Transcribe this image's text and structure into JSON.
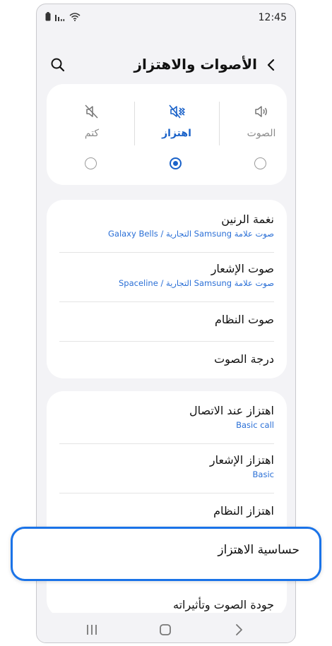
{
  "status_bar": {
    "time": "12:45",
    "icons": [
      "battery-icon",
      "signal-icon",
      "wifi-icon"
    ]
  },
  "header": {
    "title": "الأصوات والاهتزاز",
    "back_icon": "chevron-left-icon",
    "search_icon": "search-icon"
  },
  "sound_modes": {
    "items": [
      {
        "label": "الصوت",
        "icon": "volume-icon",
        "selected": false
      },
      {
        "label": "اهتزاز",
        "icon": "vibrate-icon",
        "selected": true
      },
      {
        "label": "كتم",
        "icon": "mute-icon",
        "selected": false
      }
    ]
  },
  "sound_settings": [
    {
      "title": "نغمة الرنين",
      "subtitle": "صوت علامة Samsung التجارية / Galaxy Bells"
    },
    {
      "title": "صوت الإشعار",
      "subtitle": "صوت علامة Samsung التجارية / Spaceline"
    },
    {
      "title": "صوت النظام"
    },
    {
      "title": "درجة الصوت"
    }
  ],
  "vibration_settings": [
    {
      "title": "اهتزاز عند الاتصال",
      "subtitle": "Basic call"
    },
    {
      "title": "اهتزاز الإشعار",
      "subtitle": "Basic"
    },
    {
      "title": "اهتزاز النظام"
    },
    {
      "title": "حساسية الاهتزاز",
      "highlighted": true
    },
    {
      "title": "جودة الصوت وتأثيراته"
    }
  ],
  "nav_bar": {
    "icons": [
      "recents-icon",
      "home-icon",
      "back-icon"
    ]
  },
  "colors": {
    "accent": "#1a62c9",
    "highlight_border": "#1a73e8",
    "background": "#f3f3f6",
    "card": "#ffffff"
  }
}
